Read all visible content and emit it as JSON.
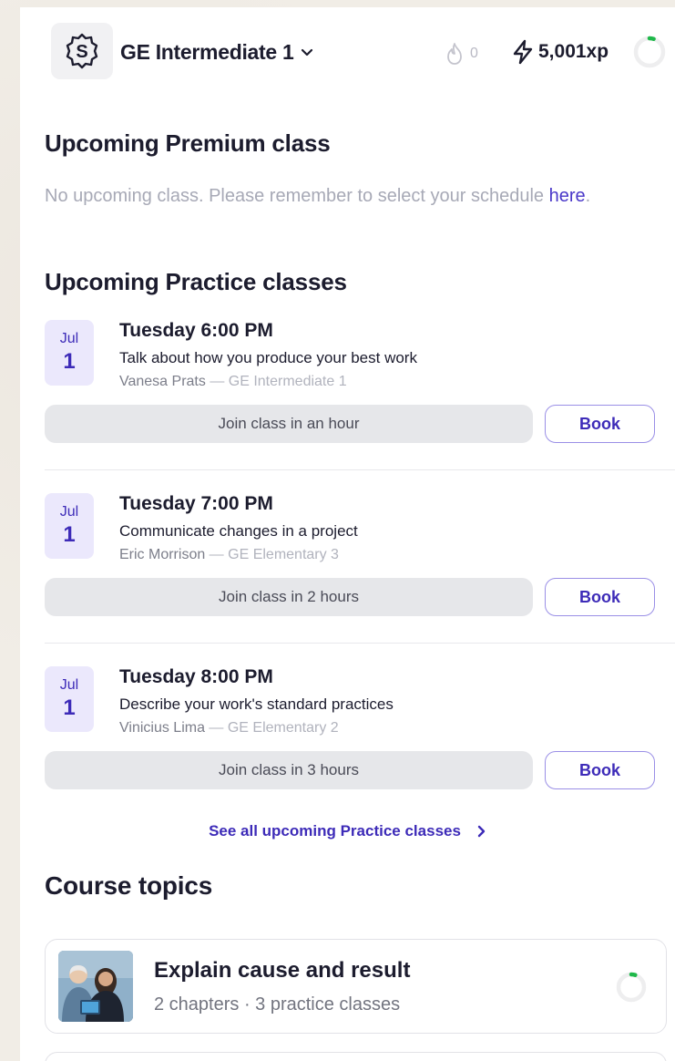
{
  "header": {
    "course_name": "GE Intermediate 1",
    "streak_count": "0",
    "xp": "5,001xp",
    "progress": 0.05
  },
  "premium": {
    "title": "Upcoming Premium class",
    "empty_text": "No upcoming class. Please remember to select your schedule ",
    "link_text": "here",
    "period": "."
  },
  "practice": {
    "title": "Upcoming Practice classes",
    "classes": [
      {
        "month": "Jul",
        "day": "1",
        "time": "Tuesday 6:00 PM",
        "topic": "Talk about how you produce your best work",
        "teacher": "Vanesa Prats",
        "separator": " — ",
        "level": "GE Intermediate 1",
        "join_label": "Join class in an hour",
        "book_label": "Book"
      },
      {
        "month": "Jul",
        "day": "1",
        "time": "Tuesday 7:00 PM",
        "topic": "Communicate changes in a project",
        "teacher": "Eric Morrison",
        "separator": " — ",
        "level": "GE Elementary 3",
        "join_label": "Join class in 2 hours",
        "book_label": "Book"
      },
      {
        "month": "Jul",
        "day": "1",
        "time": "Tuesday 8:00 PM",
        "topic": "Describe your work's standard practices",
        "teacher": "Vinicius Lima",
        "separator": " — ",
        "level": "GE Elementary 2",
        "join_label": "Join class in 3 hours",
        "book_label": "Book"
      }
    ],
    "see_all_label": "See all upcoming Practice classes"
  },
  "topics": {
    "title": "Course topics",
    "items": [
      {
        "title": "Explain cause and result",
        "meta": "2 chapters · 3 practice classes",
        "progress": 0.05
      }
    ]
  },
  "colors": {
    "accent": "#3d2bb8",
    "progress_green": "#1fb84a",
    "badge_bg": "#ebe8fc"
  },
  "icons": {
    "logo": "s-logo-icon",
    "dropdown": "chevron-down-icon",
    "streak": "flame-icon",
    "xp": "lightning-icon",
    "see_all": "chevron-right-icon"
  }
}
